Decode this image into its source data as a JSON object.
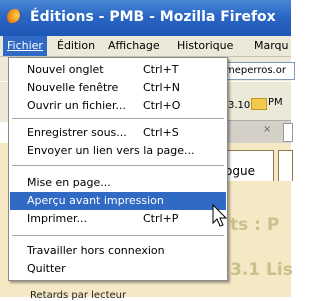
{
  "window": {
    "title": "Éditions - PMB - Mozilla Firefox"
  },
  "menubar": {
    "items": [
      {
        "label": "Fichier",
        "active": true
      },
      {
        "label": "Édition"
      },
      {
        "label": "Affichage"
      },
      {
        "label": "Historique"
      },
      {
        "label": "Marqu"
      }
    ]
  },
  "background": {
    "url_fragment": "meperros.or",
    "bookmark_text": "3.10",
    "bookmark_pm": "PM",
    "tab_close": "×",
    "page_tab": "ogue",
    "heading_1": "ts : P",
    "heading_2": "3.1 Lis",
    "footer_text": "Retards par lecteur"
  },
  "file_menu": {
    "items": [
      {
        "label": "Nouvel onglet",
        "shortcut": "Ctrl+T"
      },
      {
        "label": "Nouvelle fenêtre",
        "shortcut": "Ctrl+N"
      },
      {
        "label": "Ouvrir un fichier...",
        "shortcut": "Ctrl+O"
      },
      {
        "label": "Enregistrer sous...",
        "shortcut": "Ctrl+S"
      },
      {
        "label": "Envoyer un lien vers la page...",
        "shortcut": ""
      },
      {
        "label": "Mise en page...",
        "shortcut": ""
      },
      {
        "label": "Aperçu avant impression",
        "shortcut": "",
        "highlighted": true
      },
      {
        "label": "Imprimer...",
        "shortcut": "Ctrl+P"
      },
      {
        "label": "Travailler hors connexion",
        "shortcut": ""
      },
      {
        "label": "Quitter",
        "shortcut": ""
      }
    ]
  },
  "colors": {
    "titlebar": "#2a66c4",
    "menu_highlight": "#316ac5",
    "menubar_bg": "#ece9d8",
    "page_bg": "#f5e8c4"
  },
  "icons": {
    "app": "firefox-logo-icon",
    "cursor": "mouse-pointer-icon",
    "folder": "bookmark-folder-icon"
  }
}
